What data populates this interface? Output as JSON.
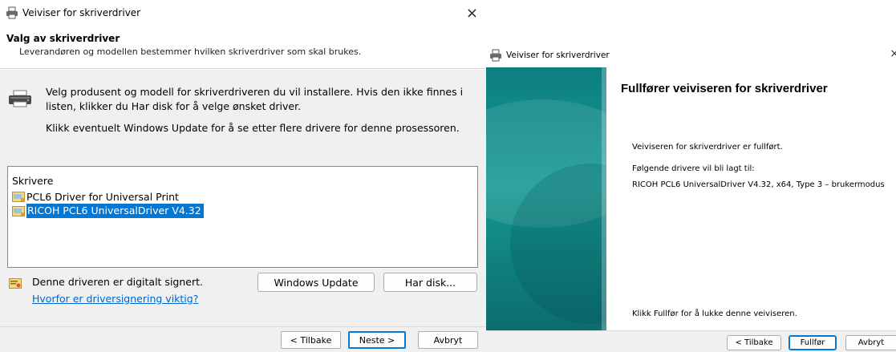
{
  "left_dialog": {
    "window_title": "Veiviser for skriverdriver",
    "close_glyph": "×",
    "header": {
      "title": "Valg av skriverdriver",
      "subtitle": "Leverandøren og modellen bestemmer hvilken skriverdriver som skal brukes."
    },
    "intro_text": "Velg produsent og modell for skriverdriveren du vil installere. Hvis den ikke finnes i listen, klikker du Har disk for å velge ønsket driver.",
    "windows_update_hint": "Klikk eventuelt Windows Update for å se etter flere drivere for denne prosessoren.",
    "printer_list": {
      "header": "Skrivere",
      "items": [
        {
          "label": "PCL6 Driver for Universal Print",
          "selected": false,
          "icon": "printer-driver-icon"
        },
        {
          "label": "RICOH PCL6 UniversalDriver V4.32",
          "selected": true,
          "icon": "printer-driver-icon"
        }
      ]
    },
    "signed_text": "Denne driveren er digitalt signert.",
    "signing_link": "Hvorfor er driversignering viktig?",
    "buttons": {
      "windows_update": "Windows Update",
      "have_disk": "Har disk...",
      "back": "< Tilbake",
      "next": "Neste >",
      "cancel": "Avbryt"
    }
  },
  "right_dialog": {
    "window_title": "Veiviser for skriverdriver",
    "close_glyph": "×",
    "heading": "Fullfører veiviseren for skriverdriver",
    "done_text": "Veiviseren for skriverdriver er fullført.",
    "following_text": "Følgende drivere vil bli lagt til:",
    "driver_line": "RICOH PCL6 UniversalDriver V4.32, x64, Type 3 – brukermodus",
    "close_hint": "Klikk Fullfør for å lukke denne veiviseren.",
    "buttons": {
      "back": "< Tilbake",
      "finish": "Fullfør",
      "cancel": "Avbryt"
    }
  },
  "colors": {
    "selection": "#0078d7",
    "link": "#0066cc",
    "banner": "#179a93",
    "panel_bg": "#f0f0f0"
  }
}
